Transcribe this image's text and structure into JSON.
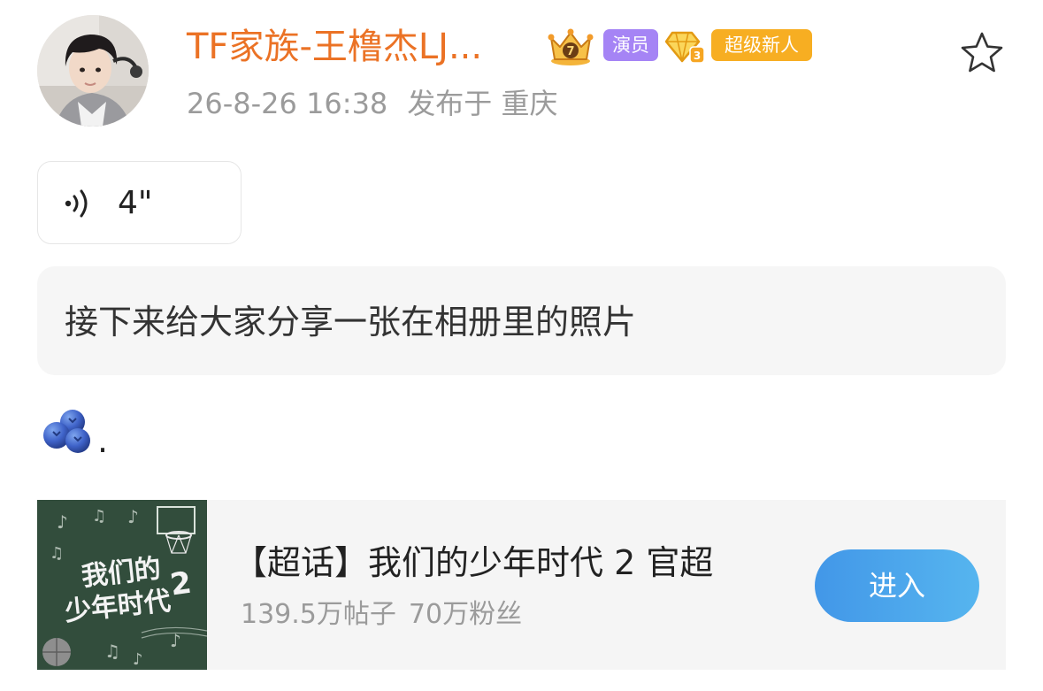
{
  "post": {
    "author": {
      "name": "TF家族-王橹杰LJ...",
      "badges": {
        "crown_icon": "crown-level-7-icon",
        "actor_label": "演员",
        "diamond_icon": "diamond-level-3-icon",
        "newbie_label": "超级新人"
      }
    },
    "timestamp": "26-8-26 16:38",
    "location": "发布于 重庆",
    "favorite_icon": "star-outline-icon"
  },
  "voice": {
    "icon": "voice-wave-icon",
    "duration": "4\""
  },
  "message": {
    "text": "接下来给大家分享一张在相册里的照片"
  },
  "emoji_line": {
    "emoji": "blueberry-icon",
    "trailing_text": "."
  },
  "supertopic": {
    "cover_text": "我们的少年时代2",
    "title": "【超话】我们的少年时代 2 官超",
    "posts": "139.5万帖子",
    "followers": "70万粉丝",
    "enter_label": "进入"
  },
  "colors": {
    "username": "#eb7225",
    "actor_badge": "#a584f5",
    "newbie_badge": "#f7ae22",
    "enter_button": "#4aa6ec",
    "muted_text": "#9b9b9b",
    "bubble_bg": "#f6f6f6",
    "card_bg": "#f5f5f5",
    "chalkboard": "#35513f"
  }
}
